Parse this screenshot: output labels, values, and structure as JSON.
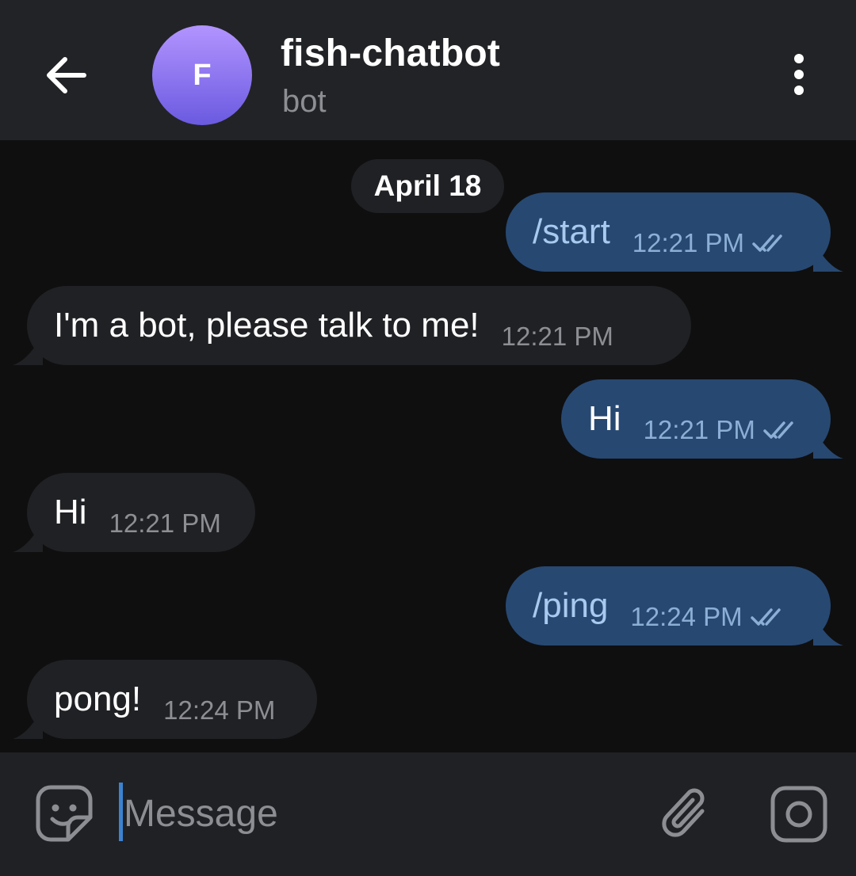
{
  "header": {
    "back_icon": "arrow-left-icon",
    "avatar_letter": "F",
    "title": "fish-chatbot",
    "subtitle": "bot",
    "menu_icon": "more-vertical-icon"
  },
  "date_label": "April 18",
  "messages": [
    {
      "direction": "out",
      "text": "/start",
      "time": "12:21 PM",
      "status": "read"
    },
    {
      "direction": "in",
      "text": "I'm a bot, please talk to me!",
      "time": "12:21 PM"
    },
    {
      "direction": "out",
      "text": "Hi",
      "time": "12:21 PM",
      "status": "read"
    },
    {
      "direction": "in",
      "text": "Hi",
      "time": "12:21 PM"
    },
    {
      "direction": "out",
      "text": "/ping",
      "time": "12:24 PM",
      "status": "read"
    },
    {
      "direction": "in",
      "text": "pong!",
      "time": "12:24 PM"
    }
  ],
  "input": {
    "placeholder": "Message",
    "value": "",
    "sticker_icon": "sticker-icon",
    "attach_icon": "paperclip-icon",
    "camera_icon": "camera-icon"
  },
  "colors": {
    "header_bg": "#222326",
    "chat_bg": "#0f0f10",
    "outgoing_bubble": "#274871",
    "incoming_bubble": "#202124",
    "accent": "#3d82d1",
    "secondary_text": "#8d8e93"
  }
}
